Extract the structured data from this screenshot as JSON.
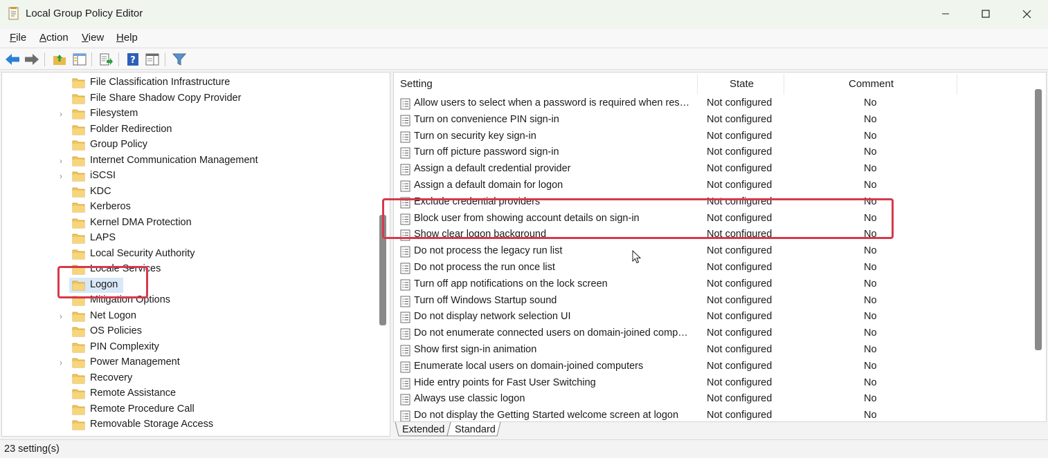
{
  "window": {
    "title": "Local Group Policy Editor",
    "controls": {
      "minimize": "minimize",
      "maximize": "maximize",
      "close": "close"
    }
  },
  "menu": {
    "items": [
      {
        "label": "File",
        "accel": "F",
        "rest": "ile"
      },
      {
        "label": "Action",
        "accel": "A",
        "rest": "ction"
      },
      {
        "label": "View",
        "accel": "V",
        "rest": "iew"
      },
      {
        "label": "Help",
        "accel": "H",
        "rest": "elp"
      }
    ]
  },
  "toolbar": {
    "icons": [
      "back-arrow-icon",
      "forward-arrow-icon",
      "up-folder-icon",
      "show-hide-tree-icon",
      "export-list-icon",
      "help-icon",
      "properties-icon",
      "filter-icon"
    ]
  },
  "tree": {
    "items": [
      {
        "label": "File Classification Infrastructure",
        "expandable": false
      },
      {
        "label": "File Share Shadow Copy Provider",
        "expandable": false
      },
      {
        "label": "Filesystem",
        "expandable": true
      },
      {
        "label": "Folder Redirection",
        "expandable": false
      },
      {
        "label": "Group Policy",
        "expandable": false
      },
      {
        "label": "Internet Communication Management",
        "expandable": true
      },
      {
        "label": "iSCSI",
        "expandable": true
      },
      {
        "label": "KDC",
        "expandable": false
      },
      {
        "label": "Kerberos",
        "expandable": false
      },
      {
        "label": "Kernel DMA Protection",
        "expandable": false
      },
      {
        "label": "LAPS",
        "expandable": false
      },
      {
        "label": "Local Security Authority",
        "expandable": false
      },
      {
        "label": "Locale Services",
        "expandable": false
      },
      {
        "label": "Logon",
        "expandable": false,
        "selected": true
      },
      {
        "label": "Mitigation Options",
        "expandable": false
      },
      {
        "label": "Net Logon",
        "expandable": true
      },
      {
        "label": "OS Policies",
        "expandable": false
      },
      {
        "label": "PIN Complexity",
        "expandable": false
      },
      {
        "label": "Power Management",
        "expandable": true
      },
      {
        "label": "Recovery",
        "expandable": false
      },
      {
        "label": "Remote Assistance",
        "expandable": false
      },
      {
        "label": "Remote Procedure Call",
        "expandable": false
      },
      {
        "label": "Removable Storage Access",
        "expandable": false
      }
    ]
  },
  "list": {
    "columns": {
      "setting": "Setting",
      "state": "State",
      "comment": "Comment"
    },
    "rows": [
      {
        "setting": "Allow users to select when a password is required when resuming from connected standby",
        "state": "Not configured",
        "comment": "No"
      },
      {
        "setting": "Turn on convenience PIN sign-in",
        "state": "Not configured",
        "comment": "No"
      },
      {
        "setting": "Turn on security key sign-in",
        "state": "Not configured",
        "comment": "No"
      },
      {
        "setting": "Turn off picture password sign-in",
        "state": "Not configured",
        "comment": "No"
      },
      {
        "setting": "Assign a default credential provider",
        "state": "Not configured",
        "comment": "No"
      },
      {
        "setting": "Assign a default domain for logon",
        "state": "Not configured",
        "comment": "No"
      },
      {
        "setting": "Exclude credential providers",
        "state": "Not configured",
        "comment": "No"
      },
      {
        "setting": "Block user from showing account details on sign-in",
        "state": "Not configured",
        "comment": "No"
      },
      {
        "setting": "Show clear logon background",
        "state": "Not configured",
        "comment": "No"
      },
      {
        "setting": "Do not process the legacy run list",
        "state": "Not configured",
        "comment": "No"
      },
      {
        "setting": "Do not process the run once list",
        "state": "Not configured",
        "comment": "No"
      },
      {
        "setting": "Turn off app notifications on the lock screen",
        "state": "Not configured",
        "comment": "No"
      },
      {
        "setting": "Turn off Windows Startup sound",
        "state": "Not configured",
        "comment": "No"
      },
      {
        "setting": "Do not display network selection UI",
        "state": "Not configured",
        "comment": "No"
      },
      {
        "setting": "Do not enumerate connected users on domain-joined computers",
        "state": "Not configured",
        "comment": "No"
      },
      {
        "setting": "Show first sign-in animation",
        "state": "Not configured",
        "comment": "No"
      },
      {
        "setting": "Enumerate local users on domain-joined computers",
        "state": "Not configured",
        "comment": "No"
      },
      {
        "setting": "Hide entry points for Fast User Switching",
        "state": "Not configured",
        "comment": "No"
      },
      {
        "setting": "Always use classic logon",
        "state": "Not configured",
        "comment": "No"
      },
      {
        "setting": "Do not display the Getting Started welcome screen at logon",
        "state": "Not configured",
        "comment": "No"
      }
    ]
  },
  "tabs": [
    {
      "label": "Extended"
    },
    {
      "label": "Standard"
    }
  ],
  "status": {
    "text": "23 setting(s)"
  },
  "colors": {
    "highlight": "#d6394a",
    "selection": "#d8e8f7",
    "folder": "#f2c75c"
  }
}
